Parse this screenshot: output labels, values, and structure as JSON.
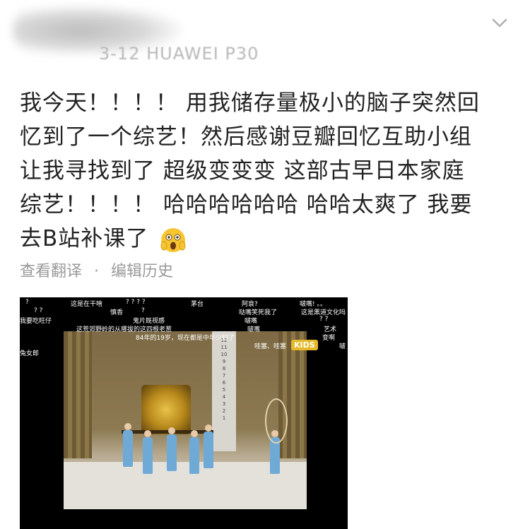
{
  "header": {
    "meta_text": "3-12  HUAWEI P30"
  },
  "post": {
    "lines": [
      "我今天！！！！ 用我储存量极小的脑子突然回",
      "忆到了一个综艺！然后感谢豆瓣回忆互助小组",
      "让我寻找到了 超级变变变 这部古早日本家庭",
      "综艺！！！！ 哈哈哈哈哈哈 哈哈太爽了 我要",
      "去B站补课了"
    ],
    "emoji": "scream-emoji"
  },
  "actions": {
    "translate": "查看翻译",
    "separator": "·",
    "history": "编辑历史"
  },
  "video": {
    "kids_badge": "KIDS",
    "danmaku": [
      "?",
      "这是在干啥",
      "? ? ?  ?",
      "茅台",
      "阿衰?",
      "啵嘴! 。。",
      "? ?",
      "慎香",
      "?",
      "哒嘴笑死我了",
      "这是黑道文化吗",
      "我要吃旺仔",
      "鬼片既视感",
      "啵嘴",
      "? ?",
      "这荒郊野岭的从哪拔的这四根老葱",
      "啵嘴",
      "艺术",
      "84年的19岁，现在都是中年少妇了",
      "哇塞、哇塞",
      "变啊",
      "兔女郎",
      "啵"
    ],
    "numbers": [
      "12",
      "11",
      "10",
      "9",
      "8",
      "7",
      "6",
      "5",
      "4",
      "3",
      "2",
      "1"
    ]
  }
}
